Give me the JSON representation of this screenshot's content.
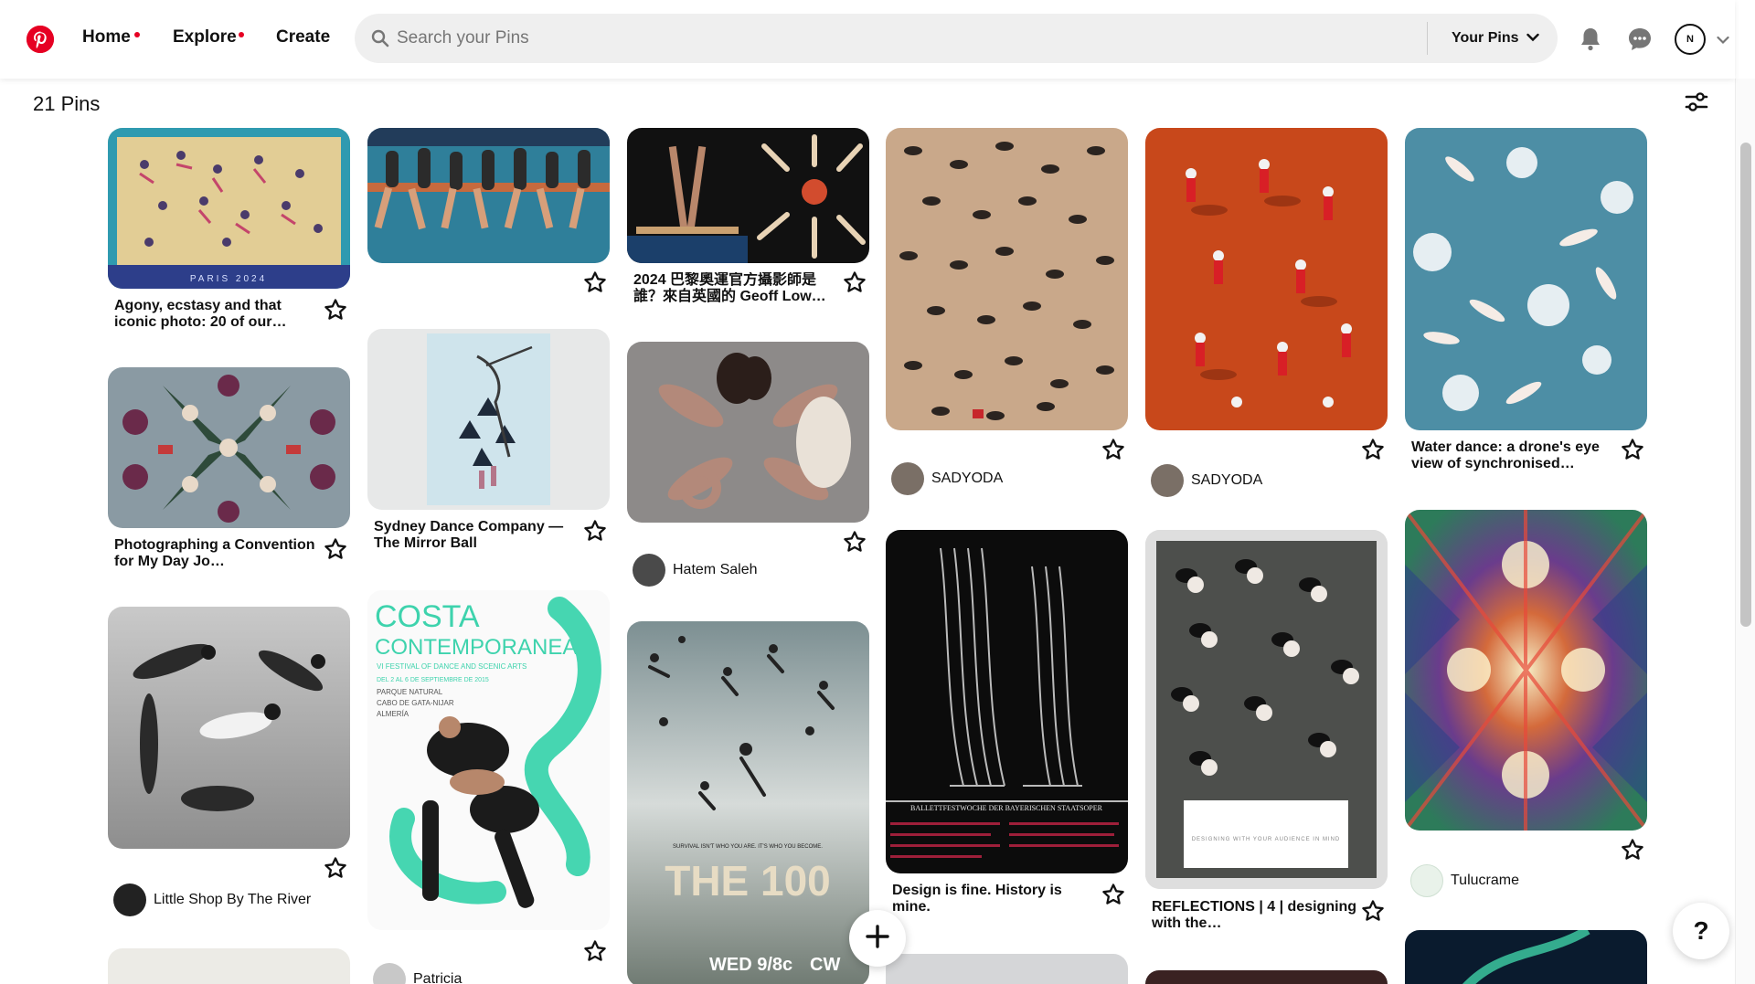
{
  "header": {
    "logo_icon": "pinterest-logo-icon",
    "nav": [
      {
        "label": "Home",
        "has_dot": true
      },
      {
        "label": "Explore",
        "has_dot": true
      },
      {
        "label": "Create",
        "has_dot": false
      }
    ],
    "search_placeholder": "Search your Pins",
    "scope_label": "Your Pins",
    "avatar_initial": "N",
    "accent_color": "#e60023"
  },
  "board": {
    "pins_count_label": "21 Pins"
  },
  "pins": [
    {
      "title": "Agony, ecstasy and that iconic photo: 20 of our…",
      "image_caption": "PARIS 2024"
    },
    {
      "title": ""
    },
    {
      "title": "2024 巴黎奧運官方攝影師是誰？來自英國的 Geoff Low…"
    },
    {
      "title": "",
      "creator": "SADYODA"
    },
    {
      "title": "",
      "creator": "SADYODA"
    },
    {
      "title": "Water dance: a drone's eye view of synchronised…"
    },
    {
      "title": "Photographing a Convention for My Day Jo…"
    },
    {
      "title": "Sydney Dance Company — The Mirror Ball"
    },
    {
      "title": "",
      "creator": "Hatem Saleh"
    },
    {
      "title": "Design is fine. History is mine.",
      "image_caption": "BALLETTFESTWOCHE DER BAYERISCHEN STAATSOPER"
    },
    {
      "title": "REFLECTIONS | 4 | designing with the…",
      "image_caption": "DESIGNING WITH YOUR AUDIENCE IN MIND"
    },
    {
      "title": "",
      "creator": "Tulucrame"
    },
    {
      "title": "",
      "creator": "Little Shop By The River"
    },
    {
      "title": "",
      "creator": "Patricia",
      "poster": {
        "line1": "COSTA",
        "line2": "CONTEMPORANEA",
        "line3": "VI FESTIVAL OF DANCE AND SCENIC ARTS",
        "line4": "DEL 2 AL 6 DE SEPTIEMBRE DE 2015",
        "line5": "PARQUE NATURAL",
        "line6": "CABO DE GATA-NIJAR",
        "line7": "ALMERÍA"
      }
    },
    {
      "title": "",
      "poster": {
        "tagline": "SURVIVAL ISN'T WHO YOU ARE. IT'S WHO YOU BECOME.",
        "show": "THE 100",
        "air": "WED 9/8c",
        "network": "CW"
      }
    }
  ],
  "floating": {
    "create_icon": "plus-icon",
    "help_label": "?"
  }
}
